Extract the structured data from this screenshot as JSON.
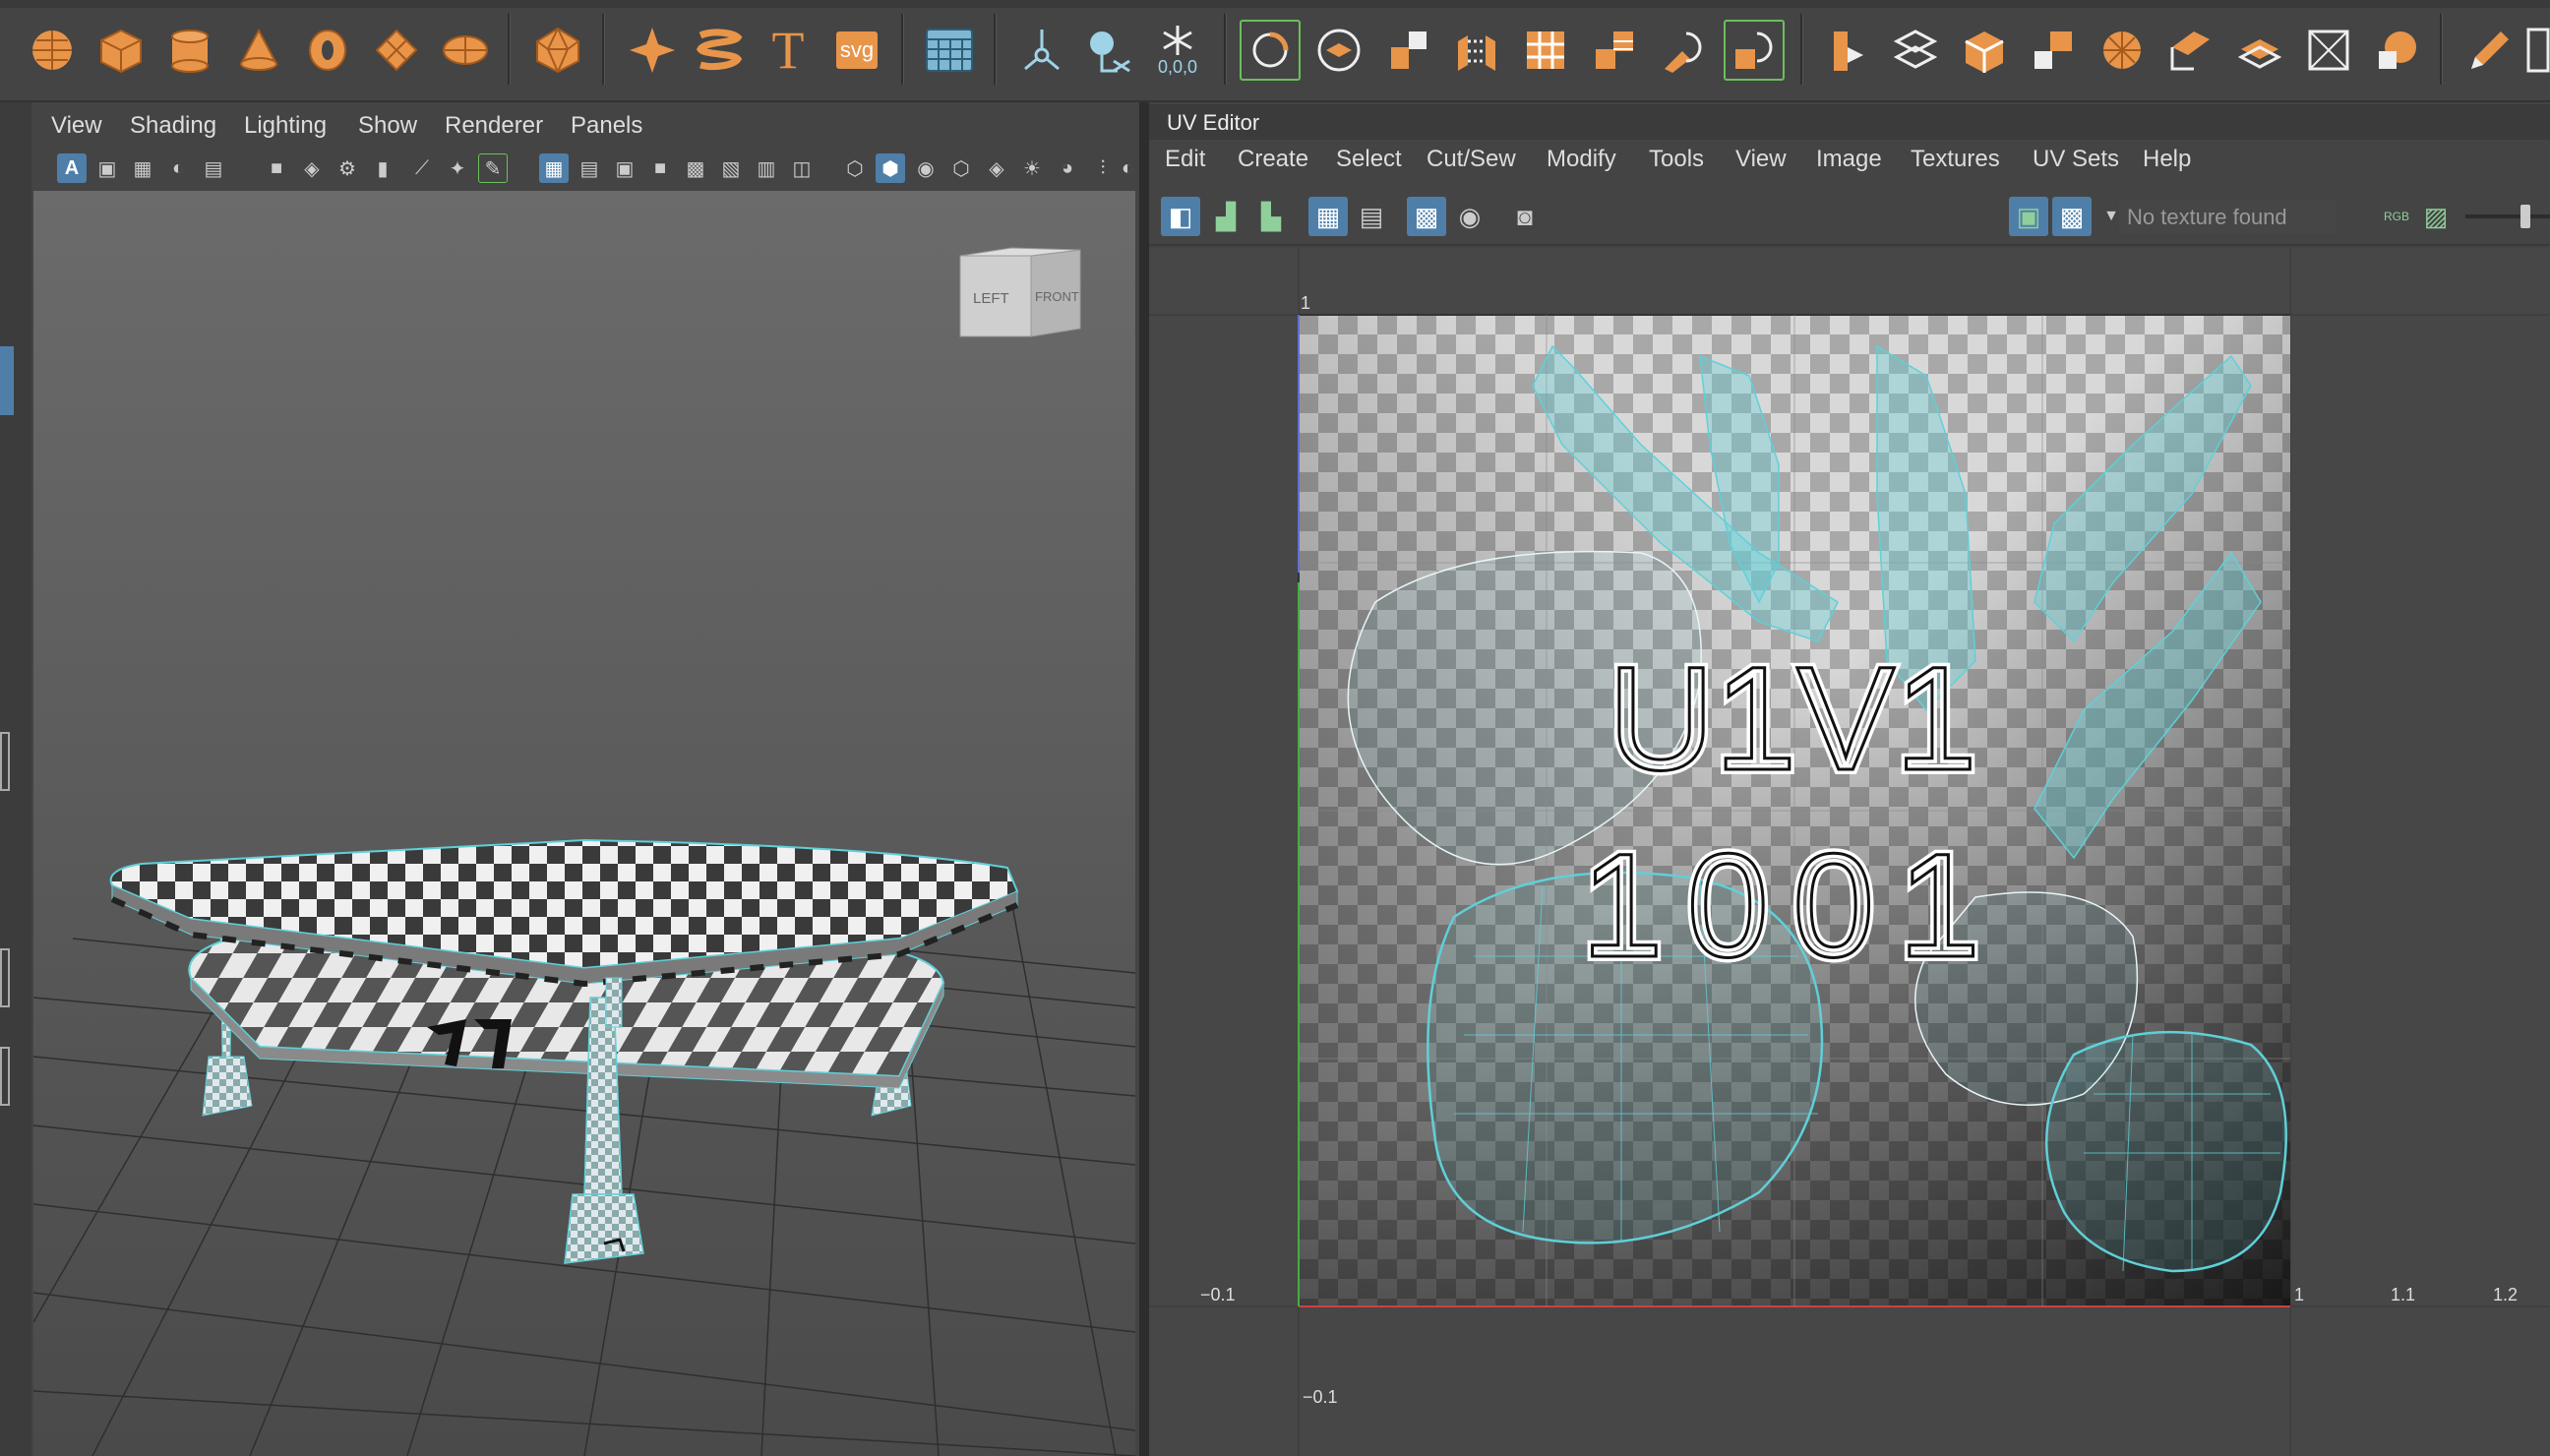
{
  "shelf": {
    "icons": [
      "sphere-icon",
      "cube-icon",
      "cylinder-icon",
      "cone-icon",
      "torus-icon",
      "plane-icon",
      "disc-icon",
      "platonic-icon",
      "sweep-icon",
      "helix-icon",
      "text-icon",
      "svg-icon",
      "grid-icon",
      "pivot-icon",
      "measure-icon",
      "freeze-icon",
      "select-icon",
      "extrude-icon",
      "bevel-icon",
      "bridge-icon",
      "combine-icon",
      "separate-icon",
      "mirror-icon",
      "boolean-icon",
      "smooth-icon",
      "retopo-icon",
      "unfold-icon",
      "layout-icon",
      "cut-icon",
      "sew-icon",
      "texture-icon",
      "pencil-icon"
    ],
    "text_icon": "T",
    "svg_label": "svg",
    "freeze_label": "0,0,0"
  },
  "viewport": {
    "menu": [
      "View",
      "Shading",
      "Lighting",
      "Show",
      "Renderer",
      "Panels"
    ],
    "viewcube": {
      "left": "LEFT",
      "front": "FRONT"
    }
  },
  "uv_editor": {
    "title": "UV Editor",
    "menu": [
      "Edit",
      "Create",
      "Select",
      "Cut/Sew",
      "Modify",
      "Tools",
      "View",
      "Image",
      "Textures",
      "UV Sets",
      "Help"
    ],
    "texture_status": "No texture found",
    "rgb_label": "RGB",
    "tile_label": "U1V1",
    "tile_number": "1001",
    "axis": {
      "top_one": "1",
      "x_neg": "−0.1",
      "x_one": "1",
      "x_1_1": "1.1",
      "x_1_2": "1.2",
      "y_neg": "−0.1"
    }
  },
  "colors": {
    "accent": "#4f7fa8",
    "wire": "#5fd0d8",
    "shelf_orange": "#e8954a"
  }
}
